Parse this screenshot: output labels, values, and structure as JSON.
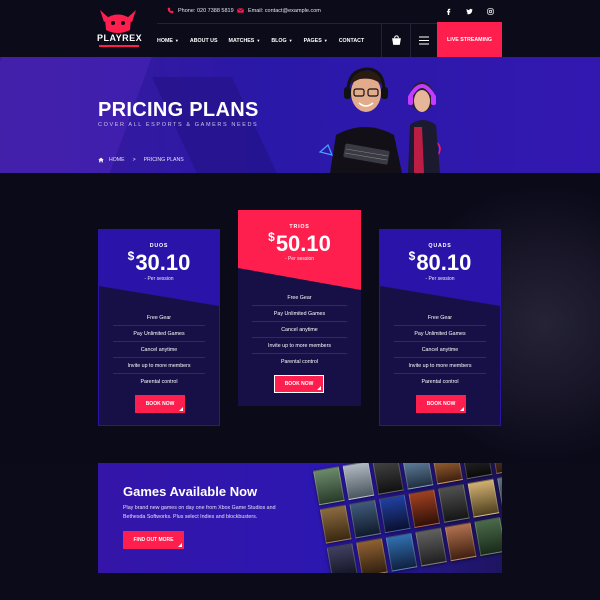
{
  "brand": {
    "name": "PLAYREX"
  },
  "topbar": {
    "phone": "Phone: 020 7388 5819",
    "email": "Email: contact@example.com",
    "social": [
      "facebook-icon",
      "twitter-icon",
      "instagram-icon"
    ]
  },
  "nav": {
    "items": [
      {
        "label": "HOME",
        "dropdown": true
      },
      {
        "label": "ABOUT US",
        "dropdown": false
      },
      {
        "label": "MATCHES",
        "dropdown": true
      },
      {
        "label": "BLOG",
        "dropdown": true
      },
      {
        "label": "PAGES",
        "dropdown": true
      },
      {
        "label": "CONTACT",
        "dropdown": false
      }
    ],
    "live_button": "LIVE STREAMING"
  },
  "hero": {
    "title": "PRICING PLANS",
    "subtitle": "COVER ALL ESPORTS & GAMERS NEEDS",
    "breadcrumb": {
      "home": "HOME",
      "separator": ">",
      "current": "PRICING PLANS"
    }
  },
  "pricing": {
    "plans": [
      {
        "name": "DUOS",
        "currency": "$",
        "price": "30.10",
        "period": "- Per session",
        "features": [
          "Free Gear",
          "Pay Unlimited Games",
          "Cancel anytime",
          "Invite up to more members",
          "Parental control"
        ],
        "button": "BOOK NOW"
      },
      {
        "name": "TRIOS",
        "currency": "$",
        "price": "50.10",
        "period": "- Per session",
        "features": [
          "Free Gear",
          "Pay Unlimited Games",
          "Cancel anytime",
          "Invite up to more members",
          "Parental control"
        ],
        "button": "BOOK NOW"
      },
      {
        "name": "QUADS",
        "currency": "$",
        "price": "80.10",
        "period": "- Per session",
        "features": [
          "Free Gear",
          "Pay Unlimited Games",
          "Cancel anytime",
          "Invite up to more members",
          "Parental control"
        ],
        "button": "BOOK NOW"
      }
    ]
  },
  "games": {
    "title": "Games Available Now",
    "description": "Play brand new games on day one from Xbox Game Studios and Bethesda Softworks. Plus select Indies and blockbusters.",
    "button": "FIND OUT MORE"
  },
  "colors": {
    "accent": "#ff1f4f",
    "card_top_primary": "#2a13a8",
    "card_body": "#161047",
    "background": "#0c0b1a"
  }
}
